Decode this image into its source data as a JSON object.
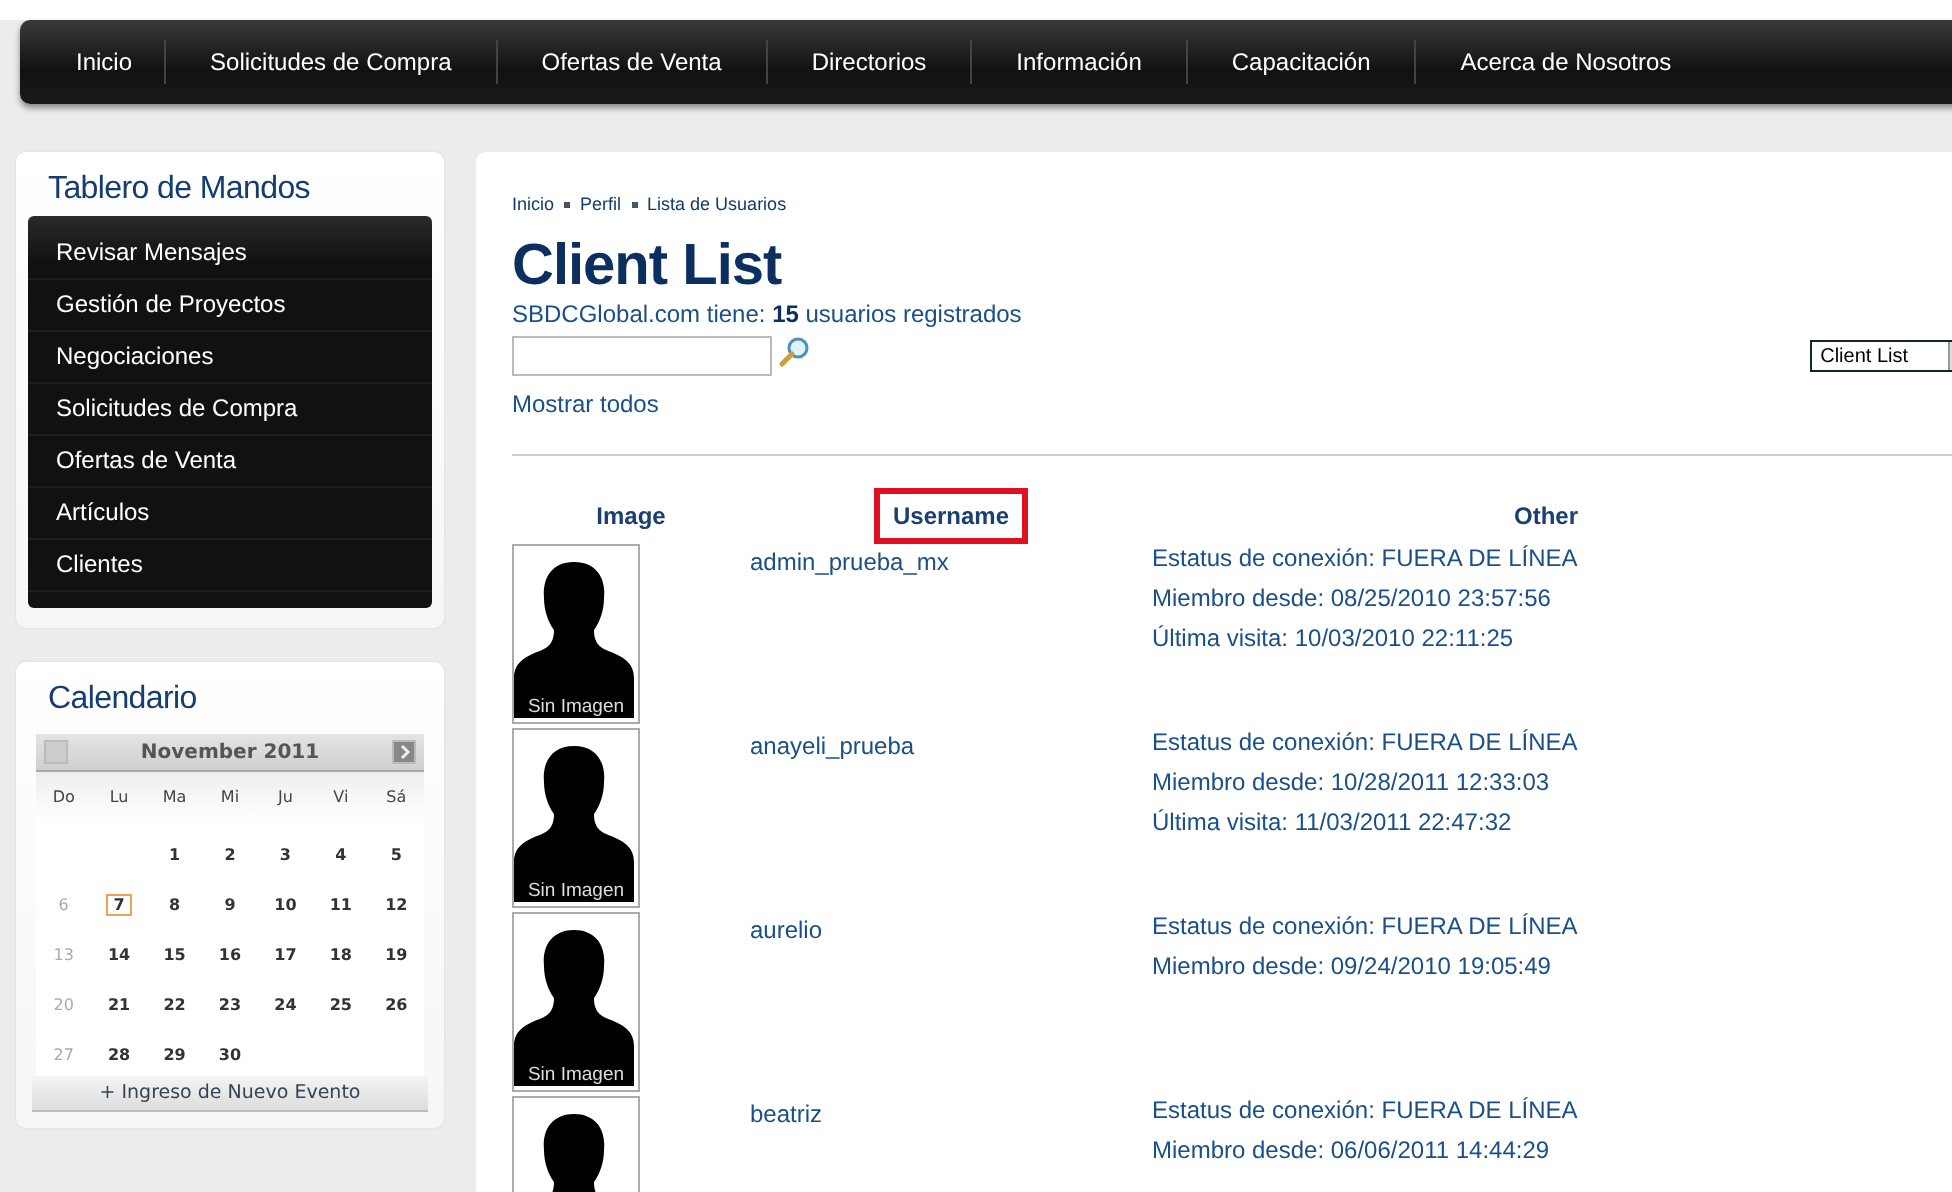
{
  "nav": [
    {
      "label": "Inicio"
    },
    {
      "label": "Solicitudes de Compra"
    },
    {
      "label": "Ofertas de Venta"
    },
    {
      "label": "Directorios"
    },
    {
      "label": "Información"
    },
    {
      "label": "Capacitación"
    },
    {
      "label": "Acerca de Nosotros"
    }
  ],
  "dashboard": {
    "title": "Tablero de Mandos",
    "items": [
      {
        "label": "Revisar Mensajes"
      },
      {
        "label": "Gestión de Proyectos"
      },
      {
        "label": "Negociaciones"
      },
      {
        "label": "Solicitudes de Compra"
      },
      {
        "label": "Ofertas de Venta"
      },
      {
        "label": "Artículos"
      },
      {
        "label": "Clientes"
      }
    ]
  },
  "calendar": {
    "title": "Calendario",
    "month": "November 2011",
    "weekdays": [
      "Do",
      "Lu",
      "Ma",
      "Mi",
      "Ju",
      "Vi",
      "Sá"
    ],
    "weeks": [
      [
        {
          "kind": "blank"
        },
        {
          "kind": "blank"
        },
        {
          "kind": "day",
          "day": "1",
          "muted": false,
          "today": false
        },
        {
          "kind": "day",
          "day": "2",
          "muted": false,
          "today": false
        },
        {
          "kind": "day",
          "day": "3",
          "muted": false,
          "today": false
        },
        {
          "kind": "day",
          "day": "4",
          "muted": false,
          "today": false
        },
        {
          "kind": "day",
          "day": "5",
          "muted": false,
          "today": false
        }
      ],
      [
        {
          "kind": "day",
          "day": "6",
          "muted": true,
          "today": false
        },
        {
          "kind": "day",
          "day": "7",
          "muted": false,
          "today": true
        },
        {
          "kind": "day",
          "day": "8",
          "muted": false,
          "today": false
        },
        {
          "kind": "day",
          "day": "9",
          "muted": false,
          "today": false
        },
        {
          "kind": "day",
          "day": "10",
          "muted": false,
          "today": false
        },
        {
          "kind": "day",
          "day": "11",
          "muted": false,
          "today": false
        },
        {
          "kind": "day",
          "day": "12",
          "muted": false,
          "today": false
        }
      ],
      [
        {
          "kind": "day",
          "day": "13",
          "muted": true,
          "today": false
        },
        {
          "kind": "day",
          "day": "14",
          "muted": false,
          "today": false
        },
        {
          "kind": "day",
          "day": "15",
          "muted": false,
          "today": false
        },
        {
          "kind": "day",
          "day": "16",
          "muted": false,
          "today": false
        },
        {
          "kind": "day",
          "day": "17",
          "muted": false,
          "today": false
        },
        {
          "kind": "day",
          "day": "18",
          "muted": false,
          "today": false
        },
        {
          "kind": "day",
          "day": "19",
          "muted": false,
          "today": false
        }
      ],
      [
        {
          "kind": "day",
          "day": "20",
          "muted": true,
          "today": false
        },
        {
          "kind": "day",
          "day": "21",
          "muted": false,
          "today": false
        },
        {
          "kind": "day",
          "day": "22",
          "muted": false,
          "today": false
        },
        {
          "kind": "day",
          "day": "23",
          "muted": false,
          "today": false
        },
        {
          "kind": "day",
          "day": "24",
          "muted": false,
          "today": false
        },
        {
          "kind": "day",
          "day": "25",
          "muted": false,
          "today": false
        },
        {
          "kind": "day",
          "day": "26",
          "muted": false,
          "today": false
        }
      ],
      [
        {
          "kind": "day",
          "day": "27",
          "muted": true,
          "today": false
        },
        {
          "kind": "day",
          "day": "28",
          "muted": false,
          "today": false
        },
        {
          "kind": "day",
          "day": "29",
          "muted": false,
          "today": false
        },
        {
          "kind": "day",
          "day": "30",
          "muted": false,
          "today": false
        },
        {
          "kind": "blank"
        },
        {
          "kind": "blank"
        },
        {
          "kind": "blank"
        }
      ]
    ],
    "add_event": "+ Ingreso de Nuevo Evento"
  },
  "breadcrumb": [
    "Inicio",
    "Perfil",
    "Lista de Usuarios"
  ],
  "title": "Client List",
  "summary": "SBDCGlobal.com tiene: **15** usuarios registrados",
  "show_all": "Mostrar todos",
  "view_select": {
    "value": "Client List"
  },
  "table": {
    "columns": [
      {
        "label": "Image",
        "highlighted": false
      },
      {
        "label": "Username",
        "highlighted": true
      },
      {
        "label": "Other",
        "highlighted": false
      }
    ],
    "rows": [
      {
        "avatar_label": "Sin Imagen",
        "username": "admin_prueba_mx",
        "other": [
          "Estatus de conexión: FUERA DE LÍNEA",
          "Miembro desde: 08/25/2010 23:57:56",
          "Última visita: 10/03/2010 22:11:25"
        ]
      },
      {
        "avatar_label": "Sin Imagen",
        "username": "anayeli_prueba",
        "other": [
          "Estatus de conexión: FUERA DE LÍNEA",
          "Miembro desde: 10/28/2011 12:33:03",
          "Última visita: 11/03/2011 22:47:32"
        ]
      },
      {
        "avatar_label": "Sin Imagen",
        "username": "aurelio",
        "other": [
          "Estatus de conexión: FUERA DE LÍNEA",
          "Miembro desde: 09/24/2010 19:05:49"
        ]
      },
      {
        "username": "beatriz",
        "other": [
          "Estatus de conexión: FUERA DE LÍNEA",
          "Miembro desde: 06/06/2011 14:44:29"
        ]
      }
    ]
  }
}
